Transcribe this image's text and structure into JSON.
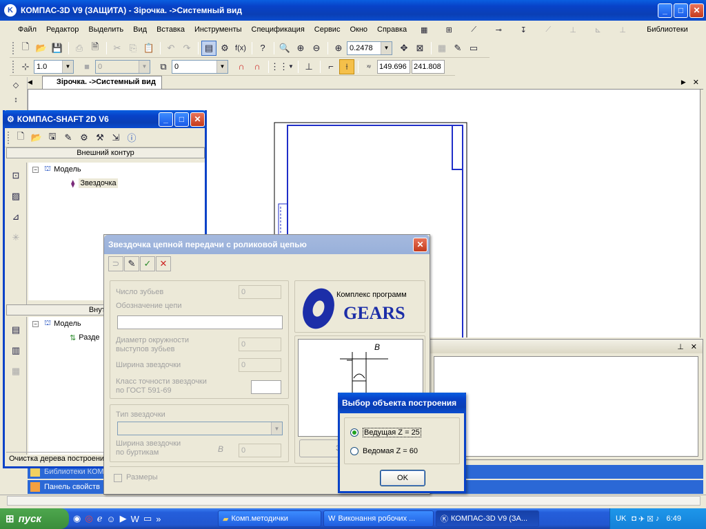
{
  "main_window": {
    "title": "КОМПАС-3D V9 (ЗАЩИТА) - Зірочка.  ->Системный вид",
    "menu": [
      "Файл",
      "Редактор",
      "Выделить",
      "Вид",
      "Вставка",
      "Инструменты",
      "Спецификация",
      "Сервис",
      "Окно",
      "Справка"
    ],
    "libraries_label": "Библиотеки",
    "zoom_value": "0.2478",
    "line_scale": "1.0",
    "style_value": "0",
    "layer_value": "0",
    "coord_x": "149.696",
    "coord_y": "241.808",
    "doc_tab": "Зірочка. ->Системный вид"
  },
  "shaft_window": {
    "title": "КОМПАС-SHAFT 2D V6",
    "outer_header": "Внешний контур",
    "inner_header": "Внутренн",
    "tree_outer": [
      {
        "label": "Модель",
        "level": 0
      },
      {
        "label": "Звездочка",
        "level": 1
      }
    ],
    "tree_inner": [
      {
        "label": "Модель",
        "level": 0
      },
      {
        "label": "Разде",
        "level": 1
      }
    ],
    "status": "Очистка дерева построения"
  },
  "sprocket_dialog": {
    "title": "Звездочка цепной передачи с роликовой цепью",
    "teeth_label": "Число зубьев",
    "teeth_value": "0",
    "chain_label": "Обозначение цепи",
    "chain_value": "",
    "tip_diameter_label_1": "Диаметр окружности",
    "tip_diameter_label_2": "выступов зубьев",
    "tip_diameter_value": "0",
    "width_label": "Ширина звездочки",
    "width_value": "0",
    "accuracy_label_1": "Класс точности звездочки",
    "accuracy_label_2": "по ГОСТ 591-69",
    "type_label": "Тип звездочки",
    "rim_width_label_1": "Ширина звездочки",
    "rim_width_label_2": "по буртикам",
    "rim_symbol": "B",
    "rim_width_value": "0",
    "dimensions_label": "Размеры",
    "logo_subtitle": "Комплекс программ",
    "logo_title": "GEARS",
    "drawing_dim": "B",
    "bottom_button_partial": "З"
  },
  "select_dialog": {
    "title": "Выбор объекта построения",
    "option1": "Ведущая Z = 25",
    "option2": "Ведомая Z = 60",
    "selected": "option1",
    "ok": "OK"
  },
  "bottom_panels": {
    "libraries": "Библиотеки КОМП",
    "properties": "Панель свойств"
  },
  "taskbar": {
    "start": "пуск",
    "tasks": [
      "Комп.методички",
      "Виконання робочих ...",
      "КОМПАС-3D V9 (ЗА..."
    ],
    "lang": "UK",
    "time": "6:49"
  }
}
